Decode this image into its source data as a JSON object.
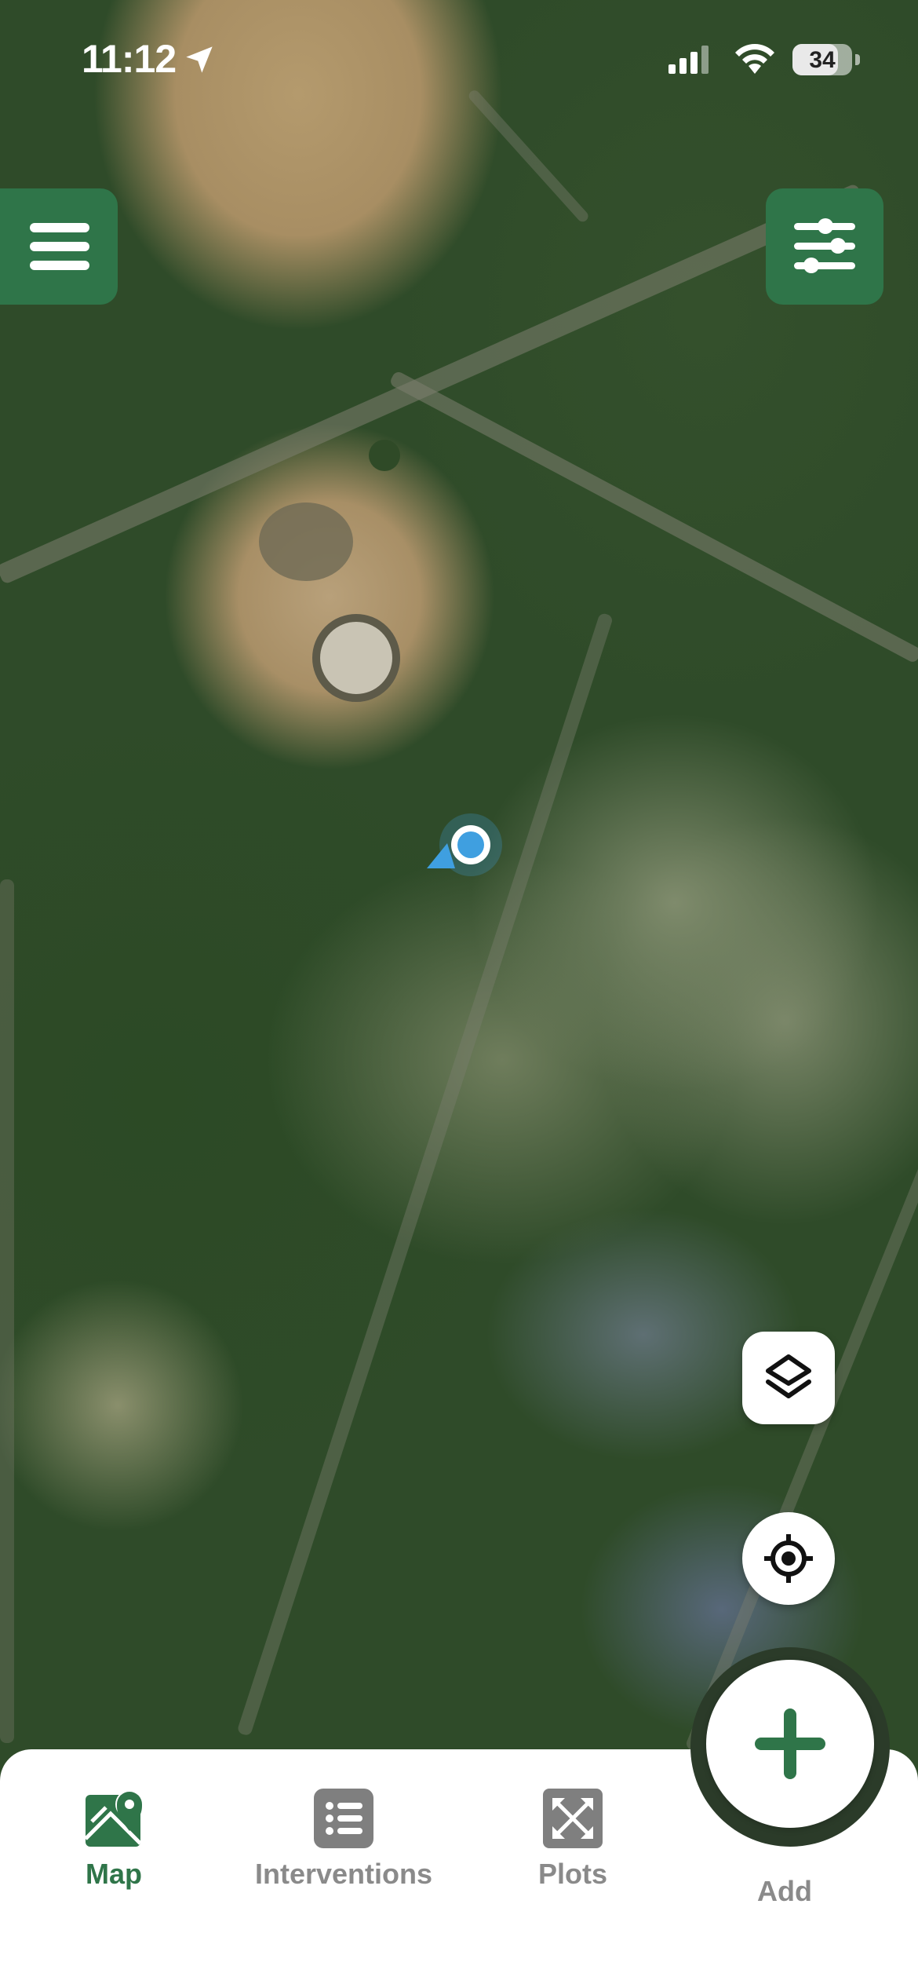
{
  "status_bar": {
    "time": "11:12",
    "battery": "34",
    "location_icon": "location-arrow-icon",
    "signal_icon": "cellular-signal-icon",
    "wifi_icon": "wifi-icon"
  },
  "map": {
    "type": "satellite",
    "user_location_icon": "user-location-marker-icon"
  },
  "top_buttons": {
    "menu_icon": "hamburger-menu-icon",
    "filter_icon": "sliders-filter-icon",
    "accent_color": "#2f7549"
  },
  "map_controls": {
    "layers_icon": "layers-icon",
    "locate_icon": "crosshair-locate-icon"
  },
  "bottom_nav": {
    "items": [
      {
        "label": "Map",
        "icon": "map-pin-icon",
        "active": true
      },
      {
        "label": "Interventions",
        "icon": "list-icon",
        "active": false
      },
      {
        "label": "Plots",
        "icon": "expand-arrows-icon",
        "active": false
      },
      {
        "label": "Add",
        "icon": "plus-icon",
        "active": false
      }
    ],
    "active_color": "#2f7549",
    "inactive_color": "#8a8a8a"
  }
}
